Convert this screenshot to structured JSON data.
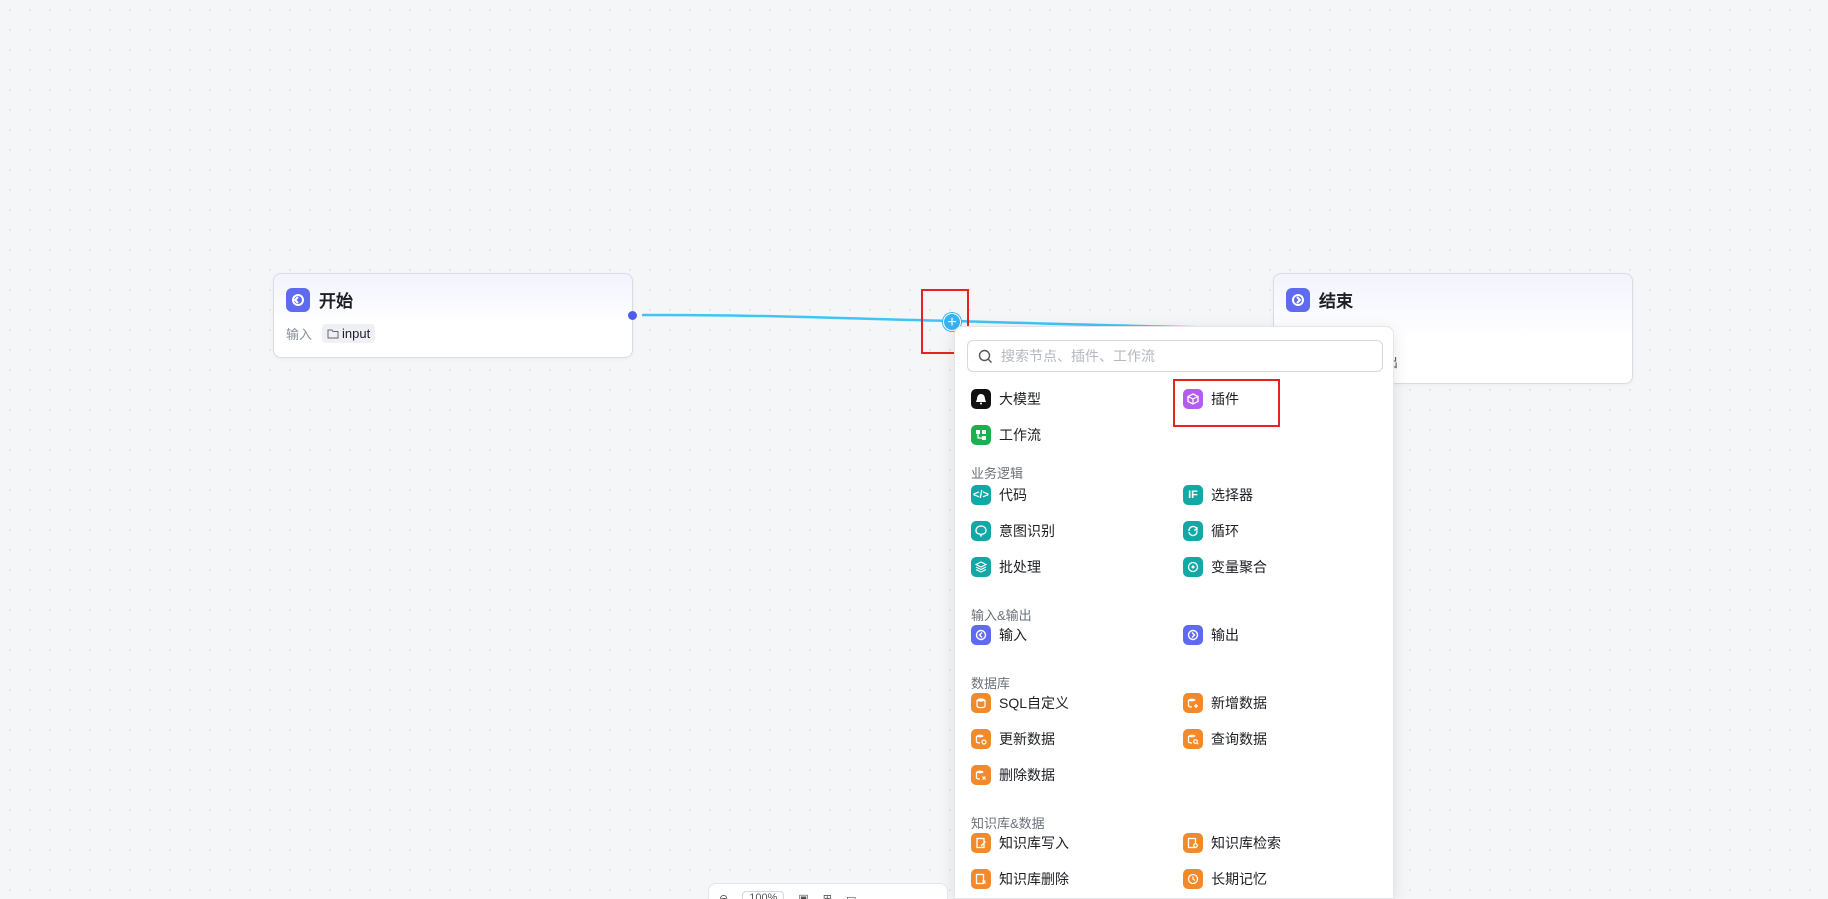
{
  "start_node": {
    "title": "开始",
    "io_label": "输入",
    "io_chip": "input"
  },
  "end_node": {
    "title": "结束",
    "chip_partial": "ut",
    "text_partial": "出"
  },
  "add_button": {
    "symbol": "+"
  },
  "node_menu": {
    "search_placeholder": "搜索节点、插件、工作流",
    "top_items": [
      {
        "label": "大模型",
        "icon": "llm-icon",
        "color": "#111111"
      },
      {
        "label": "插件",
        "icon": "plugin-icon",
        "color": "#b25cf0"
      },
      {
        "label": "工作流",
        "icon": "workflow-icon",
        "color": "#1bb04f"
      }
    ],
    "sections": [
      {
        "title": "业务逻辑",
        "items": [
          {
            "label": "代码",
            "icon": "code-icon",
            "color": "#12a8a5"
          },
          {
            "label": "选择器",
            "icon": "if-icon",
            "color": "#12a8a5"
          },
          {
            "label": "意图识别",
            "icon": "intent-icon",
            "color": "#12a8a5"
          },
          {
            "label": "循环",
            "icon": "loop-icon",
            "color": "#12a8a5"
          },
          {
            "label": "批处理",
            "icon": "batch-icon",
            "color": "#12a8a5"
          },
          {
            "label": "变量聚合",
            "icon": "variable-merge-icon",
            "color": "#12a8a5"
          }
        ]
      },
      {
        "title": "输入&输出",
        "items": [
          {
            "label": "输入",
            "icon": "input-icon",
            "color": "#5e6bf0"
          },
          {
            "label": "输出",
            "icon": "output-icon",
            "color": "#5e6bf0"
          }
        ]
      },
      {
        "title": "数据库",
        "items": [
          {
            "label": "SQL自定义",
            "icon": "sql-icon",
            "color": "#f28a2c"
          },
          {
            "label": "新增数据",
            "icon": "db-add-icon",
            "color": "#f28a2c"
          },
          {
            "label": "更新数据",
            "icon": "db-update-icon",
            "color": "#f28a2c"
          },
          {
            "label": "查询数据",
            "icon": "db-query-icon",
            "color": "#f28a2c"
          },
          {
            "label": "删除数据",
            "icon": "db-delete-icon",
            "color": "#f28a2c"
          }
        ]
      },
      {
        "title": "知识库&数据",
        "items": [
          {
            "label": "知识库写入",
            "icon": "kb-write-icon",
            "color": "#f28a2c"
          },
          {
            "label": "知识库检索",
            "icon": "kb-search-icon",
            "color": "#f28a2c"
          },
          {
            "label": "知识库删除",
            "icon": "kb-delete-icon",
            "color": "#f28a2c"
          },
          {
            "label": "长期记忆",
            "icon": "memory-icon",
            "color": "#f28a2c"
          }
        ]
      }
    ]
  },
  "toolbar": {
    "zoom": "100%"
  },
  "colors": {
    "edge": "#40c4f5",
    "highlight": "#e8231d",
    "node_accent": "#5e6bf0"
  }
}
